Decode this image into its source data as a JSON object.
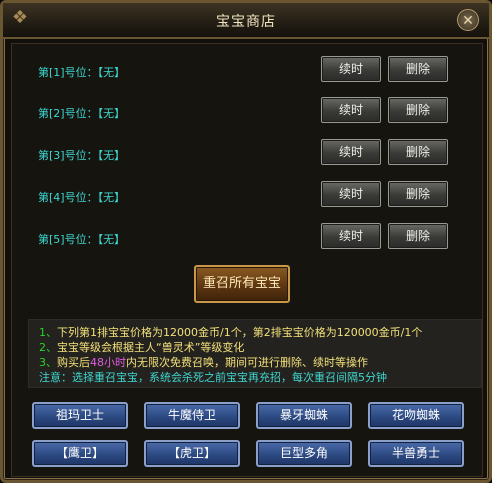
{
  "window": {
    "title": "宝宝商店"
  },
  "slots": [
    {
      "label": "第[1]号位：【无】",
      "renew": "续时",
      "delete": "删除"
    },
    {
      "label": "第[2]号位：【无】",
      "renew": "续时",
      "delete": "删除"
    },
    {
      "label": "第[3]号位：【无】",
      "renew": "续时",
      "delete": "删除"
    },
    {
      "label": "第[4]号位：【无】",
      "renew": "续时",
      "delete": "删除"
    },
    {
      "label": "第[5]号位：【无】",
      "renew": "续时",
      "delete": "删除"
    }
  ],
  "summon_all": "重召所有宝宝",
  "info": {
    "line1_num": "1、",
    "line1_text": "下列第1排宝宝价格为12000金币/1个，第2排宝宝价格为120000金币/1个",
    "line2_num": "2、",
    "line2_text": "宝宝等级会根据主人“兽灵术”等级变化",
    "line3_num": "3、",
    "line3_pre": "购买后",
    "line3_hl": "48小时",
    "line3_post": "内无限次免费召唤，期间可进行删除、续时等操作",
    "note": "注意：选择重召宝宝，系统会杀死之前宝宝再充招，每次重召间隔5分钟"
  },
  "pets": [
    [
      "祖玛卫士",
      "牛魔侍卫",
      "暴牙蜘蛛",
      "花吻蜘蛛"
    ],
    [
      "【鹰卫】",
      "【虎卫】",
      "巨型多角",
      "半兽勇士"
    ]
  ],
  "colors": {
    "accent_cyan": "#3fd7d0",
    "highlight_pink": "#e05ae0",
    "info_yellow": "#f3e07a",
    "info_green": "#28d428"
  }
}
